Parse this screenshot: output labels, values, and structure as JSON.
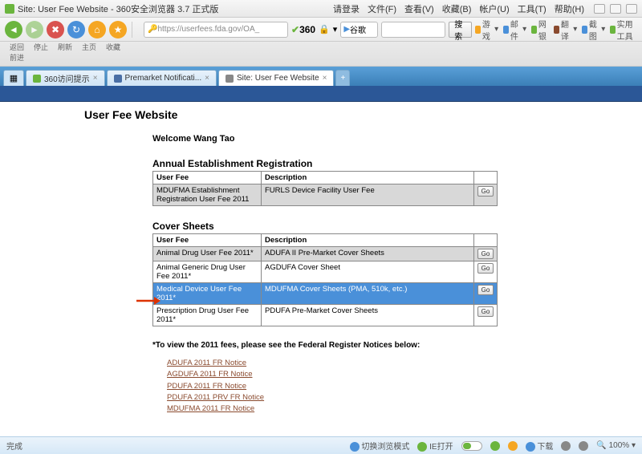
{
  "window": {
    "title": "Site: User Fee Website - 360安全浏览器 3.7 正式版",
    "menus": [
      "请登录",
      "文件(F)",
      "查看(V)",
      "收藏(B)",
      "帐户(U)",
      "工具(T)",
      "帮助(H)"
    ]
  },
  "toolbar_labels": [
    "返回前进",
    "停止",
    "刷新",
    "主页",
    "收藏"
  ],
  "address": {
    "url": "https://userfees.fda.gov/OA_",
    "lock": "🔒",
    "brand": "360",
    "search_btn": "搜索",
    "nav_dropdown": "谷歌"
  },
  "right_menu": [
    {
      "label": "游戏",
      "color": "#f5a623"
    },
    {
      "label": "邮件",
      "color": "#4a90d9"
    },
    {
      "label": "网银",
      "color": "#6bb53e"
    },
    {
      "label": "翻译",
      "color": "#8a4a2e"
    },
    {
      "label": "截图",
      "color": "#4a90d9"
    },
    {
      "label": "实用工具",
      "color": "#6bb53e"
    }
  ],
  "tabs": [
    {
      "label": "360访问提示",
      "active": false,
      "icon": "#6bb53e"
    },
    {
      "label": "Premarket Notificati...",
      "active": false,
      "icon": "#4a6fa5"
    },
    {
      "label": "Site: User Fee Website",
      "active": true,
      "icon": "#888"
    }
  ],
  "page": {
    "title": "User Fee Website",
    "welcome": "Welcome Wang Tao",
    "sections": {
      "annual": {
        "heading": "Annual Establishment Registration",
        "cols": [
          "User Fee",
          "Description"
        ],
        "rows": [
          {
            "fee": "MDUFMA Establishment Registration User Fee 2011",
            "desc": "FURLS Device Facility User Fee",
            "go": "Go"
          }
        ]
      },
      "cover": {
        "heading": "Cover Sheets",
        "cols": [
          "User Fee",
          "Description"
        ],
        "rows": [
          {
            "fee": "Animal Drug User Fee 2011*",
            "desc": "ADUFA II Pre-Market Cover Sheets",
            "go": "Go",
            "hilite": false
          },
          {
            "fee": "Animal Generic Drug User Fee 2011*",
            "desc": "AGDUFA Cover Sheet",
            "go": "Go",
            "hilite": false
          },
          {
            "fee": "Medical Device User Fee 2011*",
            "desc": "MDUFMA Cover Sheets (PMA, 510k, etc.)",
            "go": "Go",
            "hilite": true
          },
          {
            "fee": "Prescription Drug User Fee 2011*",
            "desc": "PDUFA Pre-Market Cover Sheets",
            "go": "Go",
            "hilite": false
          }
        ]
      }
    },
    "footnote": "*To view the 2011 fees, please see the Federal Register Notices below:",
    "links": [
      "ADUFA 2011 FR Notice",
      "AGDUFA 2011 FR Notice",
      "PDUFA 2011 FR Notice",
      "PDUFA 2011 PRV FR Notice",
      "MDUFMA 2011 FR Notice"
    ]
  },
  "status": {
    "left": "完成",
    "switchmode": "切换浏览模式",
    "ie": "IE打开",
    "download": "下载",
    "sound_on": true,
    "zoom": "100%"
  }
}
